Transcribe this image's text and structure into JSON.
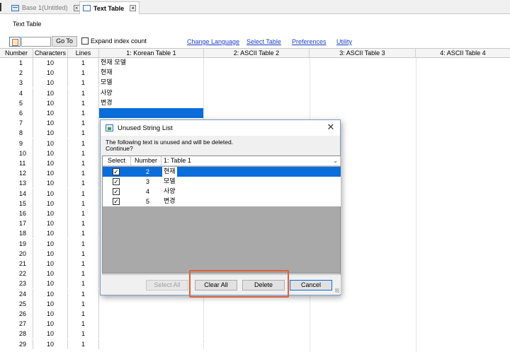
{
  "tabs": [
    {
      "label": "Base 1(Untitled)",
      "icon": "base-icon",
      "active": false
    },
    {
      "label": "Text Table",
      "icon": "text-table-icon",
      "active": true
    }
  ],
  "page": {
    "title": "Text Table"
  },
  "toolbar": {
    "goto_value": "",
    "goto_label": "Go To",
    "expand_label": "Expand index count",
    "links": [
      "Change Language",
      "Select Table",
      "Preferences",
      "Utility"
    ]
  },
  "grid": {
    "columns": [
      "Number",
      "Characters",
      "Lines",
      "1: Korean Table 1",
      "2: ASCII Table 2",
      "3: ASCII Table 3",
      "4: ASCII Table 4"
    ],
    "rows": [
      {
        "num": "1",
        "chars": "10",
        "lines": "1",
        "korean": "현재 모델"
      },
      {
        "num": "2",
        "chars": "10",
        "lines": "1",
        "korean": "현재"
      },
      {
        "num": "3",
        "chars": "10",
        "lines": "1",
        "korean": "모델"
      },
      {
        "num": "4",
        "chars": "10",
        "lines": "1",
        "korean": "사양"
      },
      {
        "num": "5",
        "chars": "10",
        "lines": "1",
        "korean": "변경"
      },
      {
        "num": "6",
        "chars": "10",
        "lines": "1",
        "korean": ""
      },
      {
        "num": "7",
        "chars": "10",
        "lines": "1",
        "korean": ""
      },
      {
        "num": "8",
        "chars": "10",
        "lines": "1",
        "korean": ""
      },
      {
        "num": "9",
        "chars": "10",
        "lines": "1",
        "korean": ""
      },
      {
        "num": "10",
        "chars": "10",
        "lines": "1",
        "korean": ""
      },
      {
        "num": "11",
        "chars": "10",
        "lines": "1",
        "korean": ""
      },
      {
        "num": "12",
        "chars": "10",
        "lines": "1",
        "korean": ""
      },
      {
        "num": "13",
        "chars": "10",
        "lines": "1",
        "korean": ""
      },
      {
        "num": "14",
        "chars": "10",
        "lines": "1",
        "korean": ""
      },
      {
        "num": "15",
        "chars": "10",
        "lines": "1",
        "korean": ""
      },
      {
        "num": "16",
        "chars": "10",
        "lines": "1",
        "korean": ""
      },
      {
        "num": "17",
        "chars": "10",
        "lines": "1",
        "korean": ""
      },
      {
        "num": "18",
        "chars": "10",
        "lines": "1",
        "korean": ""
      },
      {
        "num": "19",
        "chars": "10",
        "lines": "1",
        "korean": ""
      },
      {
        "num": "20",
        "chars": "10",
        "lines": "1",
        "korean": ""
      },
      {
        "num": "21",
        "chars": "10",
        "lines": "1",
        "korean": ""
      },
      {
        "num": "22",
        "chars": "10",
        "lines": "1",
        "korean": ""
      },
      {
        "num": "23",
        "chars": "10",
        "lines": "1",
        "korean": ""
      },
      {
        "num": "24",
        "chars": "10",
        "lines": "1",
        "korean": ""
      },
      {
        "num": "25",
        "chars": "10",
        "lines": "1",
        "korean": ""
      },
      {
        "num": "26",
        "chars": "10",
        "lines": "1",
        "korean": ""
      },
      {
        "num": "27",
        "chars": "10",
        "lines": "1",
        "korean": ""
      },
      {
        "num": "28",
        "chars": "10",
        "lines": "1",
        "korean": ""
      },
      {
        "num": "29",
        "chars": "10",
        "lines": "1",
        "korean": ""
      }
    ]
  },
  "dialog": {
    "title": "Unused String List",
    "message_line1": "The following text is unused and will be deleted.",
    "message_line2": "Continue?",
    "headers": {
      "select": "Select",
      "number": "Number",
      "table": "1: Table 1"
    },
    "items": [
      {
        "checked": true,
        "number": "2",
        "text": "현재"
      },
      {
        "checked": true,
        "number": "3",
        "text": "모델"
      },
      {
        "checked": true,
        "number": "4",
        "text": "사양"
      },
      {
        "checked": true,
        "number": "5",
        "text": "변경"
      }
    ],
    "buttons": {
      "select_all": "Select All",
      "clear_all": "Clear All",
      "delete": "Delete",
      "cancel": "Cancel"
    }
  },
  "colors": {
    "selection": "#0a6dd9",
    "link": "#1a3ec7",
    "highlight": "#d9603b"
  }
}
